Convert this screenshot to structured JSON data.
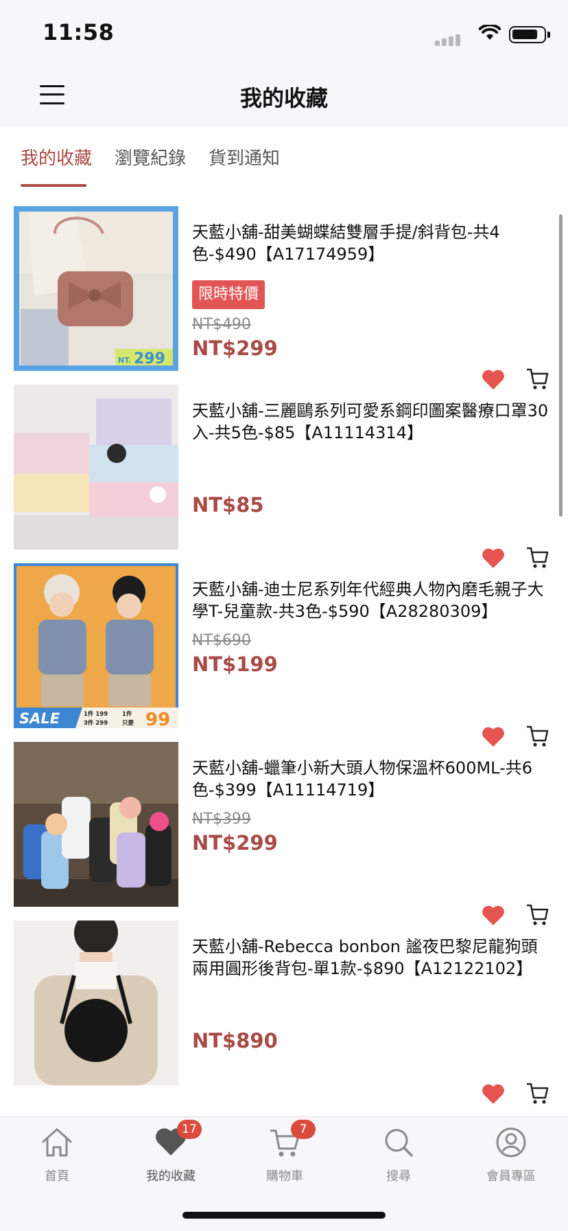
{
  "status_bar": {
    "time": "11:58"
  },
  "header": {
    "title": "我的收藏"
  },
  "tabs": [
    {
      "label": "我的收藏",
      "active": true
    },
    {
      "label": "瀏覽紀錄",
      "active": false
    },
    {
      "label": "貨到通知",
      "active": false
    }
  ],
  "products": [
    {
      "title": "天藍小舖-甜美蝴蝶結雙層手提/斜背包-共4色-$490【A17174959】",
      "badge": "限時特價",
      "old_price": "NT$490",
      "price": "NT$299",
      "thumb_overlay": {
        "prefix": "NT.",
        "amount": "299"
      }
    },
    {
      "title": "天藍小舖-三麗鷗系列可愛系鋼印圖案醫療口罩30入-共5色-$85【A11114314】",
      "badge": "",
      "old_price": "",
      "price": "NT$85"
    },
    {
      "title": "天藍小舖-迪士尼系列年代經典人物內磨毛親子大學T-兒童款-共3色-$590【A28280309】",
      "badge": "",
      "old_price": "NT$690",
      "price": "NT$199",
      "thumb_overlay": {
        "sale": "SALE",
        "line1": "1件 199",
        "line2": "3件 299",
        "one": "1件",
        "only": "只要",
        "amount": "99"
      }
    },
    {
      "title": "天藍小舖-蠟筆小新大頭人物保溫杯600ML-共6色-$399【A11114719】",
      "badge": "",
      "old_price": "NT$399",
      "price": "NT$299"
    },
    {
      "title": "天藍小舖-Rebecca bonbon 謐夜巴黎尼龍狗頭兩用圓形後背包-單1款-$890【A12122102】",
      "badge": "",
      "old_price": "",
      "price": "NT$890"
    }
  ],
  "tab_bar": [
    {
      "label": "首頁",
      "icon": "home-icon",
      "badge": ""
    },
    {
      "label": "我的收藏",
      "icon": "heart-icon",
      "badge": "17"
    },
    {
      "label": "購物車",
      "icon": "cart-icon",
      "badge": "7"
    },
    {
      "label": "搜尋",
      "icon": "search-icon",
      "badge": ""
    },
    {
      "label": "會員專區",
      "icon": "user-icon",
      "badge": ""
    }
  ],
  "colors": {
    "accent": "#a84a45",
    "heart": "#e5544f",
    "badge": "#d94b3d",
    "sale_badge": "#e25555"
  }
}
